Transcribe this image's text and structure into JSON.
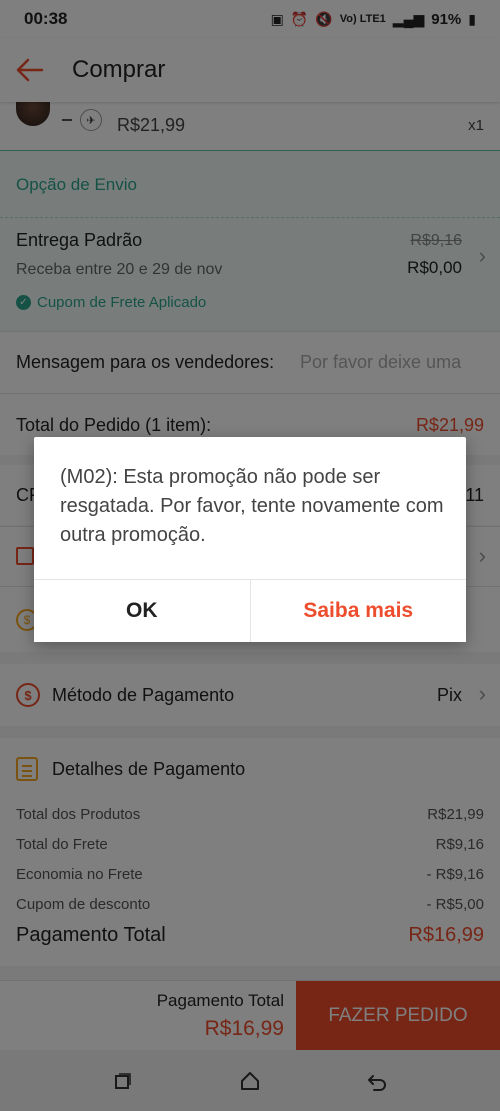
{
  "status_bar": {
    "time": "00:38",
    "network": "Vo) LTE1",
    "battery": "91%"
  },
  "header": {
    "title": "Comprar"
  },
  "product": {
    "price": "R$21,99",
    "quantity": "x1"
  },
  "shipping": {
    "section_title": "Opção de Envio",
    "method": "Entrega Padrão",
    "delivery_window": "Receba entre 20 e 29 de nov",
    "original_price": "R$9,16",
    "price": "R$0,00",
    "coupon_note": "Cupom de Frete Aplicado"
  },
  "message": {
    "label": "Mensagem para os vendedores:",
    "placeholder": "Por favor deixe uma"
  },
  "order_total": {
    "label": "Total do Pedido (1 item):",
    "value": "R$21,99"
  },
  "voucher_row": {
    "partial_text": "CF",
    "partial_value": "11"
  },
  "payment_method": {
    "label": "Método de Pagamento",
    "value": "Pix"
  },
  "payment_details": {
    "title": "Detalhes de Pagamento",
    "lines": [
      {
        "label": "Total dos Produtos",
        "value": "R$21,99"
      },
      {
        "label": "Total do Frete",
        "value": "R$9,16"
      },
      {
        "label": "Economia no Frete",
        "value": "- R$9,16"
      },
      {
        "label": "Cupom de desconto",
        "value": "- R$5,00"
      }
    ],
    "total_label": "Pagamento Total",
    "total_value": "R$16,99"
  },
  "bottom_bar": {
    "label": "Pagamento Total",
    "value": "R$16,99",
    "button": "FAZER PEDIDO"
  },
  "dialog": {
    "message": "(M02): Esta promoção não pode ser resgatada. Por favor, tente novamente com outra promoção.",
    "ok_label": "OK",
    "more_label": "Saiba mais"
  },
  "nav": {
    "recent_icon": "recent-apps-icon",
    "home_icon": "home-icon",
    "back_icon": "back-icon"
  },
  "colors": {
    "accent": "#ee4d2d",
    "teal": "#2aa58a",
    "coin": "#f5a623"
  }
}
